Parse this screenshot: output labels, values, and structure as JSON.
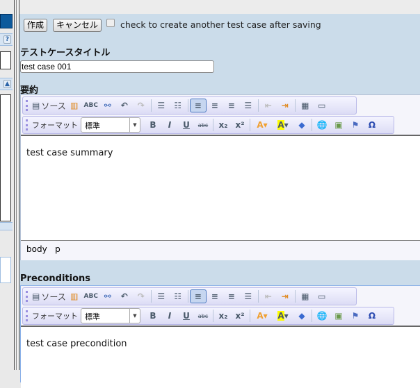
{
  "left_panel": {
    "help_label": "?",
    "collapse_label": "▲"
  },
  "form": {
    "create_button": "作成",
    "cancel_button": "キャンセル",
    "another_checkbox_label": "check to create another test case after saving",
    "another_checked": false,
    "title_label": "テストケースタイトル",
    "title_value": "test case 001",
    "summary_label": "要約",
    "preconditions_label": "Preconditions"
  },
  "toolbar": {
    "source_label": "ソース",
    "format_label": "フォーマット",
    "format_value": "標準"
  },
  "summary": {
    "content": "test case summary",
    "path": [
      "body",
      "p"
    ]
  },
  "preconditions": {
    "content": "test case precondition"
  }
}
